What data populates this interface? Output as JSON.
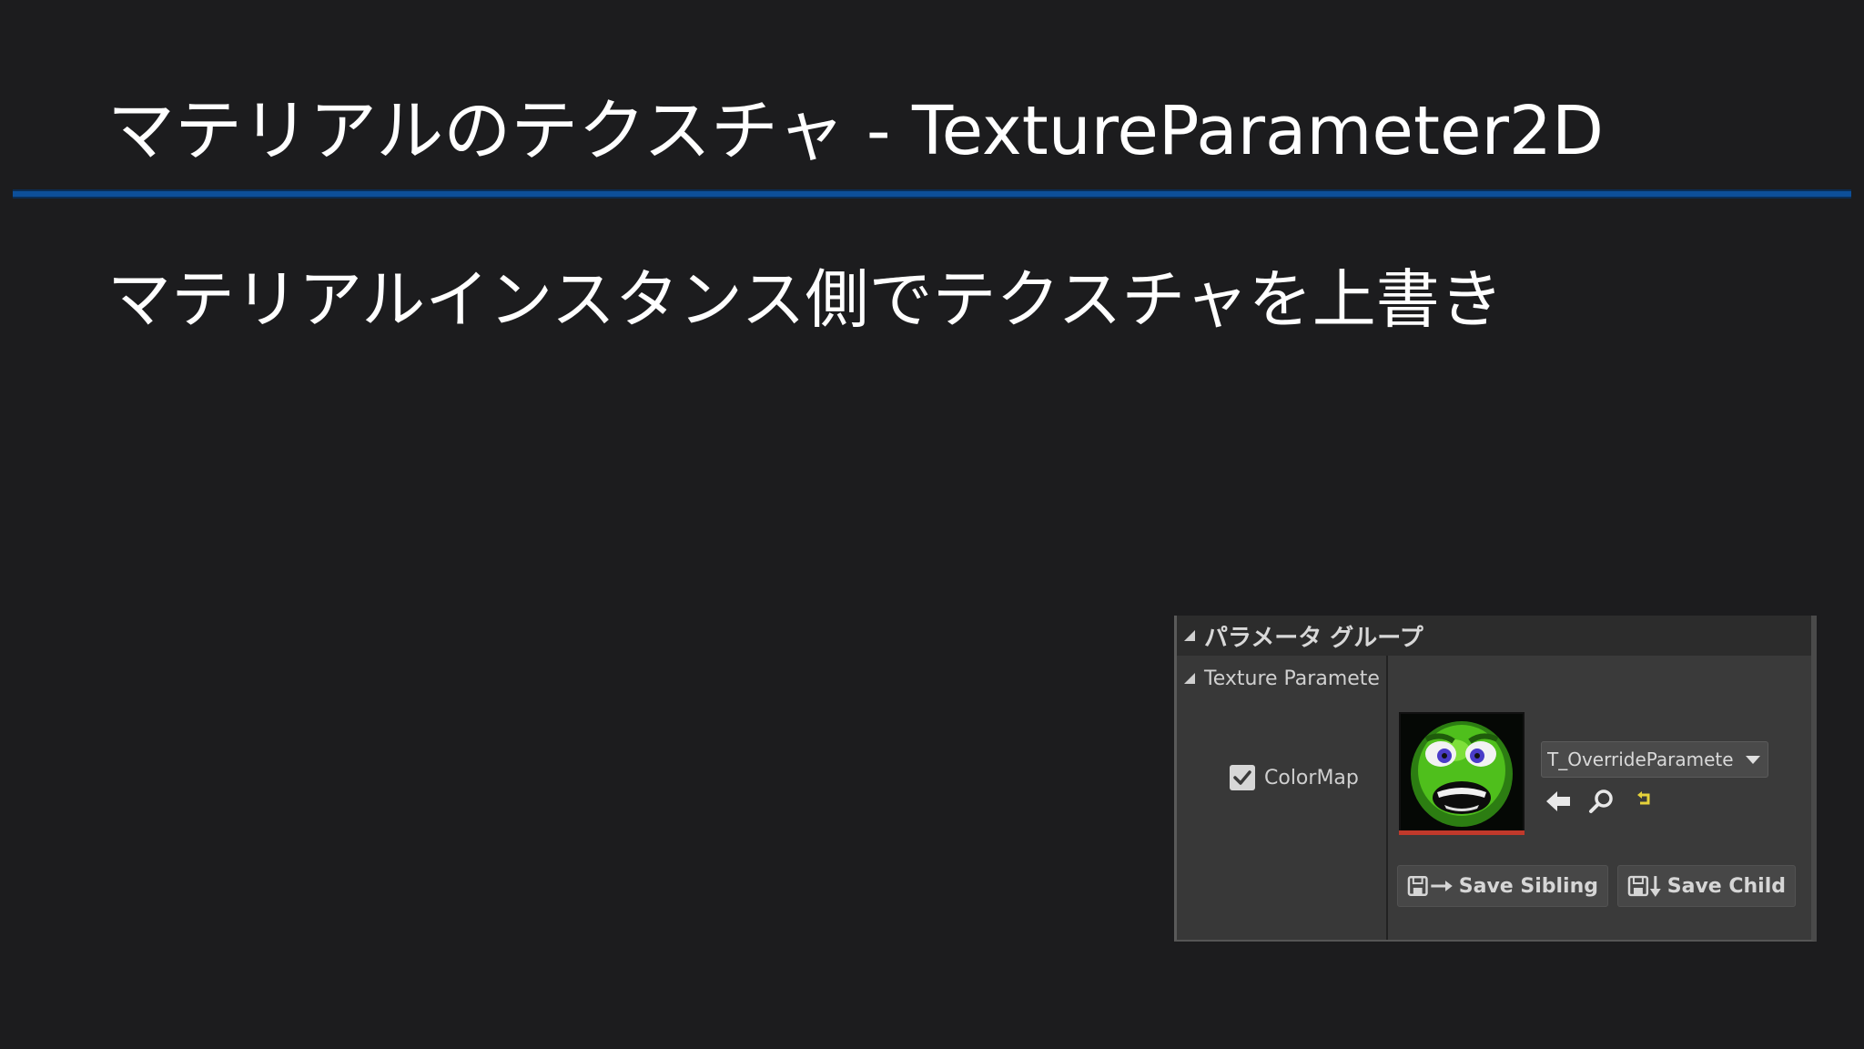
{
  "slide": {
    "title": "マテリアルのテクスチャ - TextureParameter2D",
    "subtitle": "マテリアルインスタンス側でテクスチャを上書き"
  },
  "panel": {
    "group_label": "パラメータ グループ",
    "section_label": "Texture Paramete",
    "parameter": {
      "label": "ColorMap",
      "checked": true
    },
    "asset": {
      "name": "T_OverrideParamete",
      "thumbnail": "green-monster-face-texture"
    },
    "tools": [
      "use-selected-arrow-icon",
      "browse-search-icon",
      "reset-to-default-icon"
    ],
    "buttons": {
      "save_sibling": "Save Sibling",
      "save_child": "Save Child"
    }
  },
  "colors": {
    "background": "#1c1c1e",
    "rule": "#0d4f99",
    "panel": "#3a3a3a",
    "thumbnail_bar": "#c0392b",
    "reset_icon": "#e6d23a"
  }
}
